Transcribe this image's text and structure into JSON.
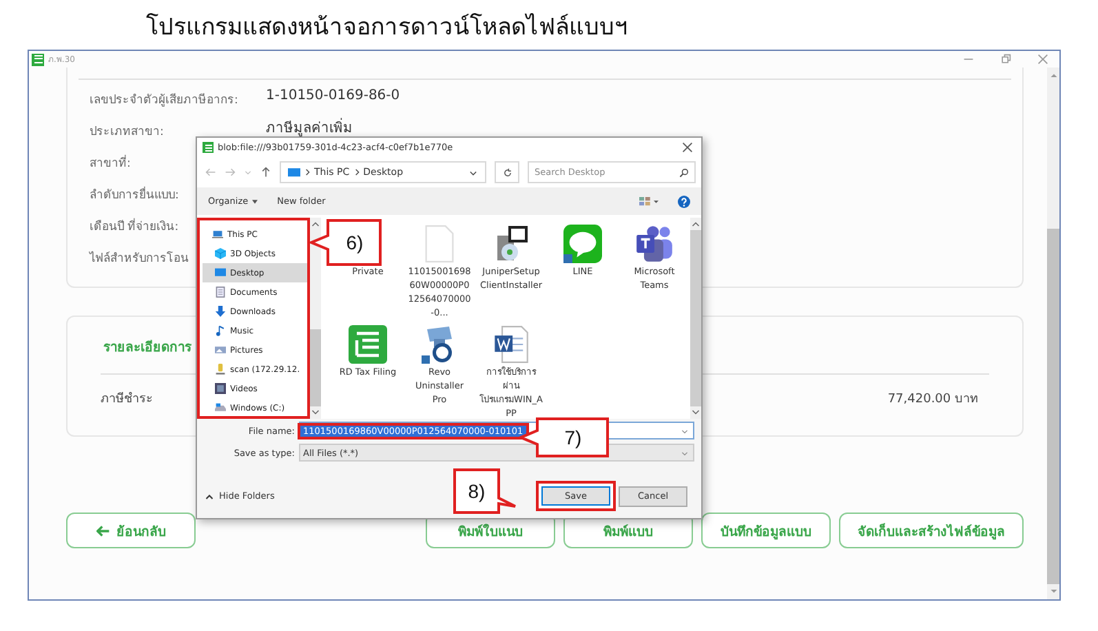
{
  "heading": "โปรแกรมแสดงหน้าจอการดาวน์โหลดไฟล์แบบฯ",
  "window": {
    "title": "ภ.พ.30"
  },
  "info_rows": [
    {
      "label": "เลขประจำตัวผู้เสียภาษีอากร:",
      "value": "1-10150-0169-86-0"
    },
    {
      "label": "ประเภทสาขา:",
      "value": "ภาษีมูลค่าเพิ่ม"
    },
    {
      "label": "สาขาที่:"
    },
    {
      "label": "ลำดับการยื่นแบบ:"
    },
    {
      "label": "เดือนปี ที่จ่ายเงิน:"
    },
    {
      "label": "ไฟล์สำหรับการโอน"
    }
  ],
  "detail": {
    "title": "รายละเอียดการ",
    "rows": [
      {
        "label": "ภาษีชำระ",
        "value": "77,420.00 บาท"
      }
    ]
  },
  "back_button": {
    "label": "ย้อนกลับ"
  },
  "actions": [
    "พิมพ์ใบแนบ",
    "พิมพ์แบบ",
    "บันทึกข้อมูลแบบ",
    "จัดเก็บและสร้างไฟล์ข้อมูล"
  ],
  "dialog": {
    "title": "blob:file:///93b01759-301d-4c23-acf4-c0ef7b1e770e",
    "path": [
      "This PC",
      "Desktop"
    ],
    "search_placeholder": "Search Desktop",
    "toolbar": [
      "Organize",
      "New folder"
    ],
    "nav_highlighted": true,
    "nav": [
      {
        "label": "This PC",
        "kind": "pc",
        "selected": false,
        "children": [
          {
            "label": "3D Objects",
            "kind": "cube",
            "selected": false
          },
          {
            "label": "Desktop",
            "kind": "desktop",
            "selected": true
          },
          {
            "label": "Documents",
            "kind": "doc",
            "selected": false
          },
          {
            "label": "Downloads",
            "kind": "download",
            "selected": false
          },
          {
            "label": "Music",
            "kind": "music",
            "selected": false
          },
          {
            "label": "Pictures",
            "kind": "pictures",
            "selected": false
          },
          {
            "label": "scan (172.29.12.",
            "kind": "netdrive",
            "selected": false
          },
          {
            "label": "Videos",
            "kind": "video",
            "selected": false
          },
          {
            "label": "Windows (C:)",
            "kind": "drive",
            "selected": false
          }
        ]
      }
    ],
    "files": [
      {
        "name": "Private"
      },
      {
        "name": "1101500169860W00000P012564070000-0...",
        "kind": "blank"
      },
      {
        "name": "JuniperSetupClientInstaller",
        "kind": "installer"
      },
      {
        "name": "LINE",
        "kind": "line"
      },
      {
        "name": "Microsoft Teams",
        "kind": "teams"
      },
      {
        "name": "RD Tax Filing",
        "kind": "rdtax"
      },
      {
        "name": "Revo Uninstaller Pro",
        "kind": "revo"
      },
      {
        "name": "การใช้บริการผ่านโปรแกรมWIN_APP",
        "kind": "word"
      }
    ],
    "file_name": {
      "label": "File name:",
      "value": "1101500169860V00000P012564070000-010101",
      "selected": true,
      "highlighted": true
    },
    "save_type": {
      "label": "Save as type:",
      "value": "All Files (*.*)"
    },
    "hide_folders": "Hide Folders",
    "buttons": [
      {
        "label": "Save",
        "default": true,
        "highlighted": true
      },
      {
        "label": "Cancel",
        "default": false,
        "highlighted": false
      }
    ]
  },
  "callouts": [
    {
      "label": "6)"
    },
    {
      "label": "7)"
    },
    {
      "label": "8)"
    }
  ]
}
